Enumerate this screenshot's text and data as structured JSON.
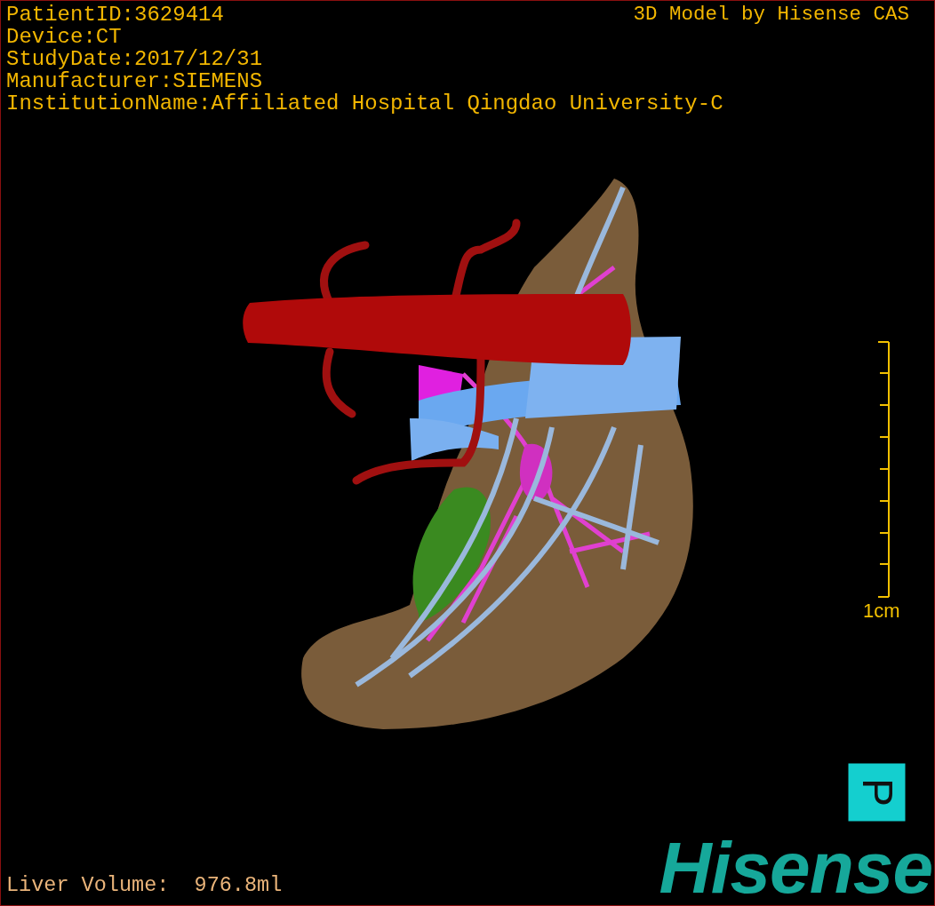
{
  "patient_info": [
    "PatientID:3629414",
    "Device:CT",
    "StudyDate:2017/12/31",
    "Manufacturer:SIEMENS",
    "InstitutionName:Affiliated Hospital Qingdao University-C"
  ],
  "title": "3D Model by Hisense CAS",
  "scale_label": "1cm",
  "orientation_label": "P",
  "logo": "Hisense",
  "volume": "Liver Volume:  976.8ml"
}
